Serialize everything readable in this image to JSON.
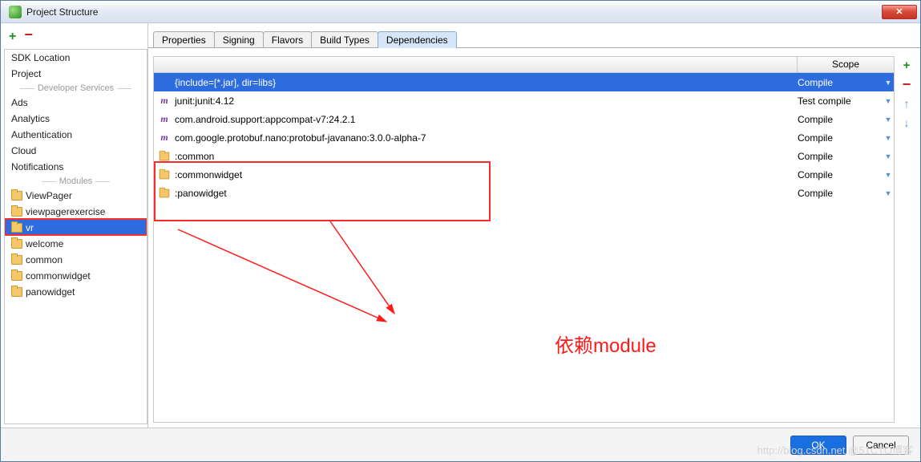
{
  "window": {
    "title": "Project Structure"
  },
  "sidebar": {
    "items": [
      "SDK Location",
      "Project"
    ],
    "sep1": "Developer Services",
    "services": [
      "Ads",
      "Analytics",
      "Authentication",
      "Cloud",
      "Notifications"
    ],
    "sep2": "Modules",
    "modules": [
      "ViewPager",
      "viewpagerexercise",
      "vr",
      "welcome",
      "common",
      "commonwidget",
      "panowidget"
    ],
    "selected_module_index": 2
  },
  "tabs": {
    "items": [
      "Properties",
      "Signing",
      "Flavors",
      "Build Types",
      "Dependencies"
    ],
    "active_index": 4
  },
  "table": {
    "scope_header": "Scope",
    "rows": [
      {
        "icon": "",
        "name": "{include=[*.jar], dir=libs}",
        "scope": "Compile",
        "selected": true
      },
      {
        "icon": "m",
        "name": "junit:junit:4.12",
        "scope": "Test compile",
        "selected": false
      },
      {
        "icon": "m",
        "name": "com.android.support:appcompat-v7:24.2.1",
        "scope": "Compile",
        "selected": false
      },
      {
        "icon": "m",
        "name": "com.google.protobuf.nano:protobuf-javanano:3.0.0-alpha-7",
        "scope": "Compile",
        "selected": false
      },
      {
        "icon": "f",
        "name": ":common",
        "scope": "Compile",
        "selected": false
      },
      {
        "icon": "f",
        "name": ":commonwidget",
        "scope": "Compile",
        "selected": false
      },
      {
        "icon": "f",
        "name": ":panowidget",
        "scope": "Compile",
        "selected": false
      }
    ]
  },
  "annotation": {
    "text": "依赖module"
  },
  "footer": {
    "ok": "OK",
    "cancel": "Cancel"
  },
  "watermark": "http://blog.csdn.net @51CTO博客"
}
